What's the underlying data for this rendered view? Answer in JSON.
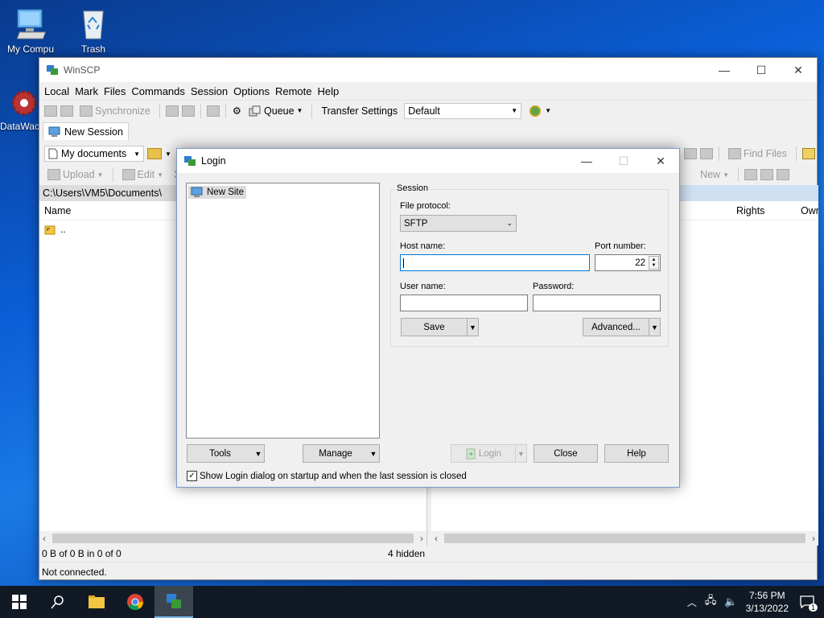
{
  "desktop": {
    "icons": [
      {
        "label": "My Compu"
      },
      {
        "label": "Trash"
      },
      {
        "label": "DataWac"
      }
    ]
  },
  "main": {
    "title": "WinSCP",
    "menu": [
      "Local",
      "Mark",
      "Files",
      "Commands",
      "Session",
      "Options",
      "Remote",
      "Help"
    ],
    "toolbar": {
      "synchronize": "Synchronize",
      "queue": "Queue",
      "transfer_settings": "Transfer Settings",
      "transfer_value": "Default"
    },
    "tab_label": "New Session",
    "local": {
      "location": "My documents",
      "upload": "Upload",
      "edit": "Edit",
      "path": "C:\\Users\\VM5\\Documents\\",
      "col_name": "Name",
      "parent_dir": ".."
    },
    "remote": {
      "find_files": "Find Files",
      "new": "New",
      "col_rights": "Rights",
      "col_owner": "Owr"
    },
    "status": {
      "selection": "0 B of 0 B in 0 of 0",
      "hidden": "4 hidden",
      "connection": "Not connected."
    }
  },
  "login": {
    "title": "Login",
    "site_item": "New Site",
    "session_group": "Session",
    "file_protocol_label": "File protocol:",
    "file_protocol_value": "SFTP",
    "host_label": "Host name:",
    "host_value": "",
    "port_label": "Port number:",
    "port_value": "22",
    "user_label": "User name:",
    "user_value": "",
    "password_label": "Password:",
    "password_value": "",
    "save": "Save",
    "advanced": "Advanced...",
    "tools": "Tools",
    "manage": "Manage",
    "login_btn": "Login",
    "close": "Close",
    "help": "Help",
    "show_on_startup": "Show Login dialog on startup and when the last session is closed",
    "show_on_startup_checked": true
  },
  "taskbar": {
    "time": "7:56 PM",
    "date": "3/13/2022",
    "notifications": "1"
  },
  "colors": {
    "accent": "#0078d7",
    "taskbar": "#111a24"
  }
}
